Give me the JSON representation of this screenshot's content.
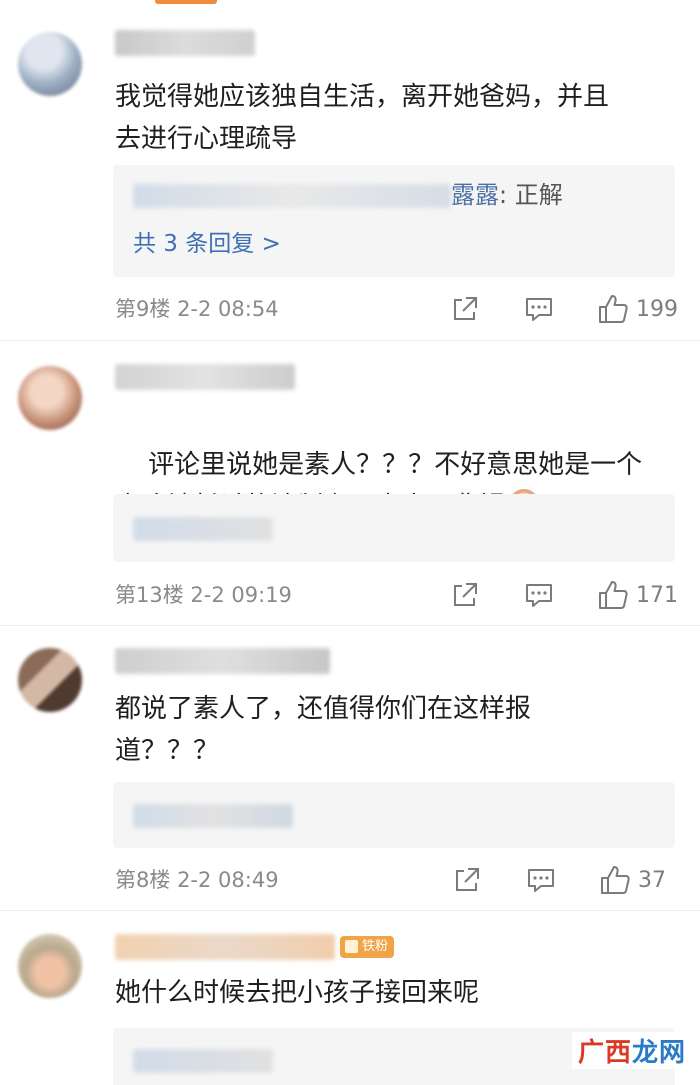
{
  "comments": [
    {
      "text": "我觉得她应该独自生活，离开她爸妈，并且\n去进行心理疏导",
      "reply_preview": {
        "name_suffix": "露露",
        "text": ": 正解"
      },
      "more_replies": "共 3 条回复 >",
      "floor": "第9楼",
      "time": "2-2 08:54",
      "likes": "199"
    },
    {
      "text": "评论里说她是素人？？？不好意思她是一个\n劣迹被封杀的法制咖，素人不背锅",
      "floor": "第13楼",
      "time": "2-2 09:19",
      "likes": "171"
    },
    {
      "text": "都说了素人了，还值得你们在这样报\n道？？？",
      "floor": "第8楼",
      "time": "2-2 08:49",
      "likes": "37"
    },
    {
      "text": "她什么时候去把小孩子接回来呢",
      "badge": "铁粉"
    }
  ],
  "watermark": {
    "part_a": "广西",
    "part_b": "龙网"
  },
  "colors": {
    "link": "#3f6fb4",
    "badge": "#f0a445",
    "accent": "#f08a3c"
  }
}
